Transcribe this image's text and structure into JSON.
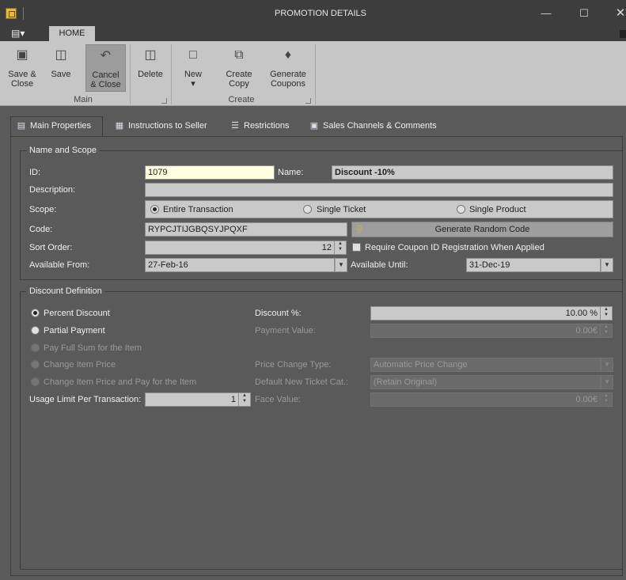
{
  "window": {
    "title": "PROMOTION DETAILS"
  },
  "ribbon": {
    "tab": "HOME",
    "buttons": [
      {
        "label1": "Save &",
        "label2": "Close",
        "icon": "save-close-icon"
      },
      {
        "label1": "Save",
        "label2": "",
        "icon": "save-icon"
      },
      {
        "label1": "Cancel",
        "label2": "& Close",
        "icon": "undo-icon"
      },
      {
        "label1": "Delete",
        "label2": "",
        "icon": "trash-icon"
      },
      {
        "label1": "New",
        "label2": "▾",
        "icon": "new-icon"
      },
      {
        "label1": "Create",
        "label2": "Copy",
        "icon": "copy-icon"
      },
      {
        "label1": "Generate",
        "label2": "Coupons",
        "icon": "coupons-icon"
      }
    ],
    "groups": {
      "main": "Main",
      "create": "Create"
    }
  },
  "tabs": [
    {
      "label": "Main Properties",
      "icon": "properties-icon"
    },
    {
      "label": "Instructions to Seller",
      "icon": "instructions-icon"
    },
    {
      "label": "Restrictions",
      "icon": "list-icon"
    },
    {
      "label": "Sales Channels & Comments",
      "icon": "channels-icon"
    }
  ],
  "name_scope": {
    "title": "Name and Scope",
    "id_label": "ID:",
    "id_value": "1079",
    "name_label": "Name:",
    "name_value": "Discount -10%",
    "description_label": "Description:",
    "description_value": "",
    "scope_label": "Scope:",
    "scope_options": [
      "Entire Transaction",
      "Single Ticket",
      "Single Product"
    ],
    "scope_selected": "Entire Transaction",
    "code_label": "Code:",
    "code_value": "RYPCJTIJGBQSYJPQXF",
    "generate_code": "Generate Random Code",
    "sort_label": "Sort Order:",
    "sort_value": "12",
    "require_coupon": "Require Coupon ID Registration When Applied",
    "require_coupon_checked": false,
    "from_label": "Available From:",
    "from_value": "27-Feb-16",
    "until_label": "Available Until:",
    "until_value": "31-Dec-19"
  },
  "discount": {
    "title": "Discount Definition",
    "types": [
      "Percent Discount",
      "Partial Payment",
      "Pay Full Sum for the Item",
      "Change Item Price",
      "Change Item Price and Pay for the Item"
    ],
    "selected": "Percent Discount",
    "usage_label": "Usage Limit Per Transaction:",
    "usage_value": "1",
    "pct_label": "Discount %:",
    "pct_value": "10.00 %",
    "payment_label": "Payment Value:",
    "payment_value": "0.00€",
    "price_change_label": "Price Change Type:",
    "price_change_value": "Automatic Price Change",
    "ticket_cat_label": "Default New Ticket Cat.:",
    "ticket_cat_value": "(Retain Original)",
    "face_label": "Face Value:",
    "face_value": "0.00€"
  }
}
